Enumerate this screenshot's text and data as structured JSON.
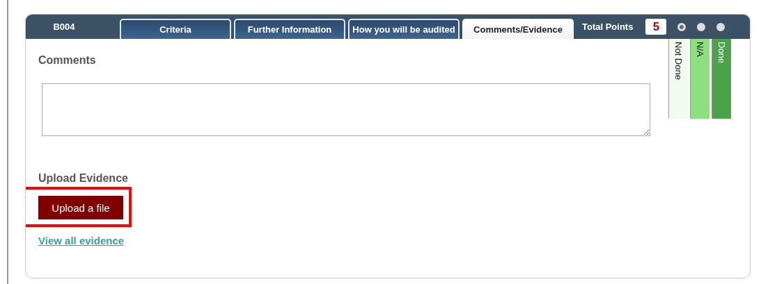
{
  "header": {
    "code": "B004",
    "total_label": "Total Points",
    "total": "5"
  },
  "tabs": [
    {
      "label": "Criteria",
      "selected": false
    },
    {
      "label": "Further Information",
      "selected": false
    },
    {
      "label": "How you will be audited",
      "selected": false
    },
    {
      "label": "Comments/Evidence",
      "selected": true
    }
  ],
  "radios": [
    {
      "selected": true
    },
    {
      "selected": false
    },
    {
      "selected": false
    }
  ],
  "statuses": [
    {
      "label": "Not Done",
      "color": "#f2fbef"
    },
    {
      "label": "N/A",
      "color": "#8edf7f"
    },
    {
      "label": "Done",
      "color": "#4aa24a"
    }
  ],
  "comments": {
    "title": "Comments"
  },
  "upload": {
    "title": "Upload Evidence",
    "button": "Upload a file",
    "highlighted": true,
    "link": "View all evidence"
  }
}
